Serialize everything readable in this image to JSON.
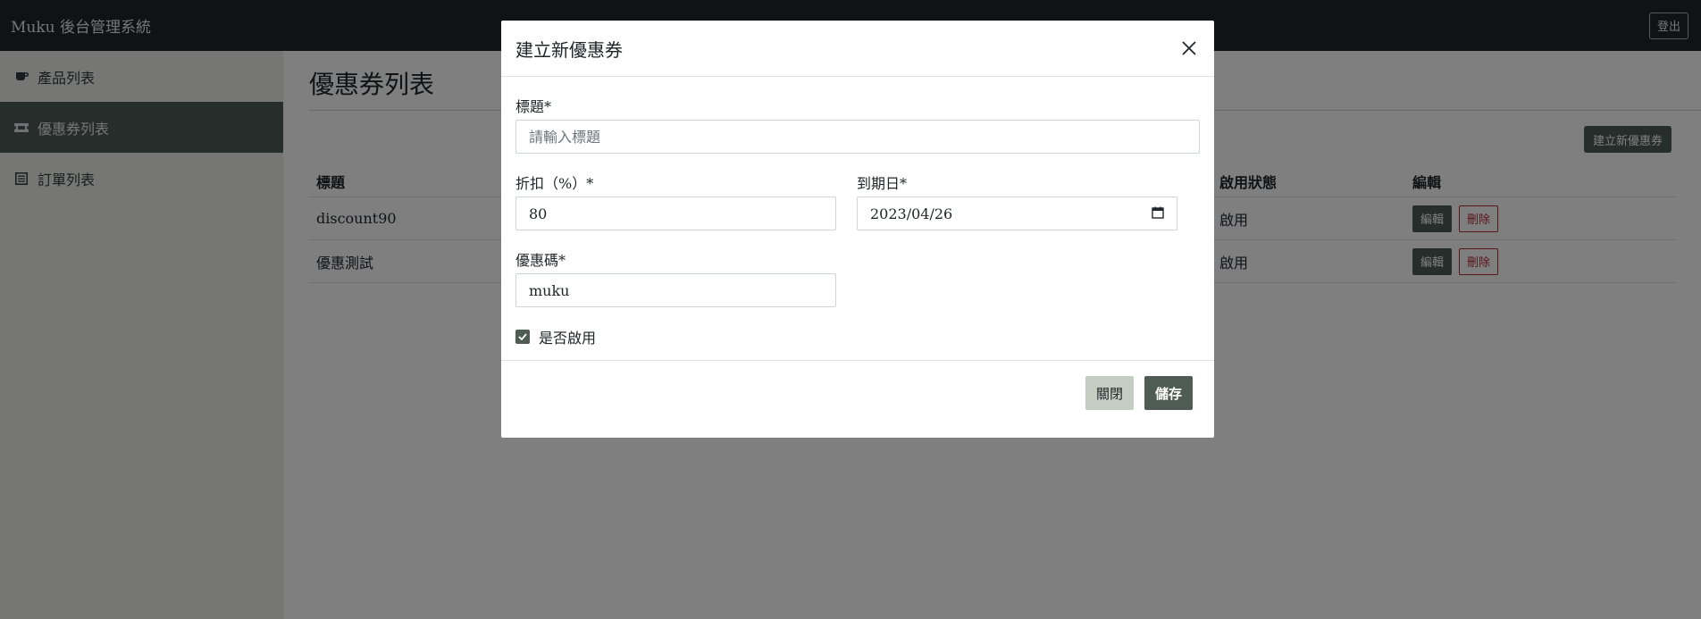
{
  "app": {
    "brand": "Muku 後台管理系統",
    "logout_label": "登出"
  },
  "sidebar": {
    "items": [
      {
        "label": "產品列表",
        "icon": "cup-icon"
      },
      {
        "label": "優惠券列表",
        "icon": "ticket-icon",
        "active": true
      },
      {
        "label": "訂單列表",
        "icon": "list-icon"
      }
    ]
  },
  "page": {
    "title": "優惠券列表",
    "create_label": "建立新優惠券",
    "table": {
      "headers": {
        "title": "標題",
        "status": "啟用狀態",
        "edit": "編輯"
      },
      "rows": [
        {
          "title": "discount90",
          "status": "啟用",
          "edit_label": "編輯",
          "delete_label": "刪除"
        },
        {
          "title": "優惠測試",
          "status": "啟用",
          "edit_label": "編輯",
          "delete_label": "刪除"
        }
      ]
    }
  },
  "modal": {
    "title": "建立新優惠券",
    "fields": {
      "title_label": "標題*",
      "title_placeholder": "請輸入標題",
      "title_value": "",
      "discount_label": "折扣（%）*",
      "discount_value": "80",
      "due_label": "到期日*",
      "due_value": "2023/04/26",
      "code_label": "優惠碼*",
      "code_value": "muku",
      "enabled_label": "是否啟用",
      "enabled": true
    },
    "close_label": "關閉",
    "save_label": "儲存"
  },
  "colors": {
    "primary": "#4f5b55",
    "navbar": "#212529",
    "sidebar": "#ecedeb",
    "danger": "#b02a37",
    "secondary": "#c5cdc3"
  }
}
